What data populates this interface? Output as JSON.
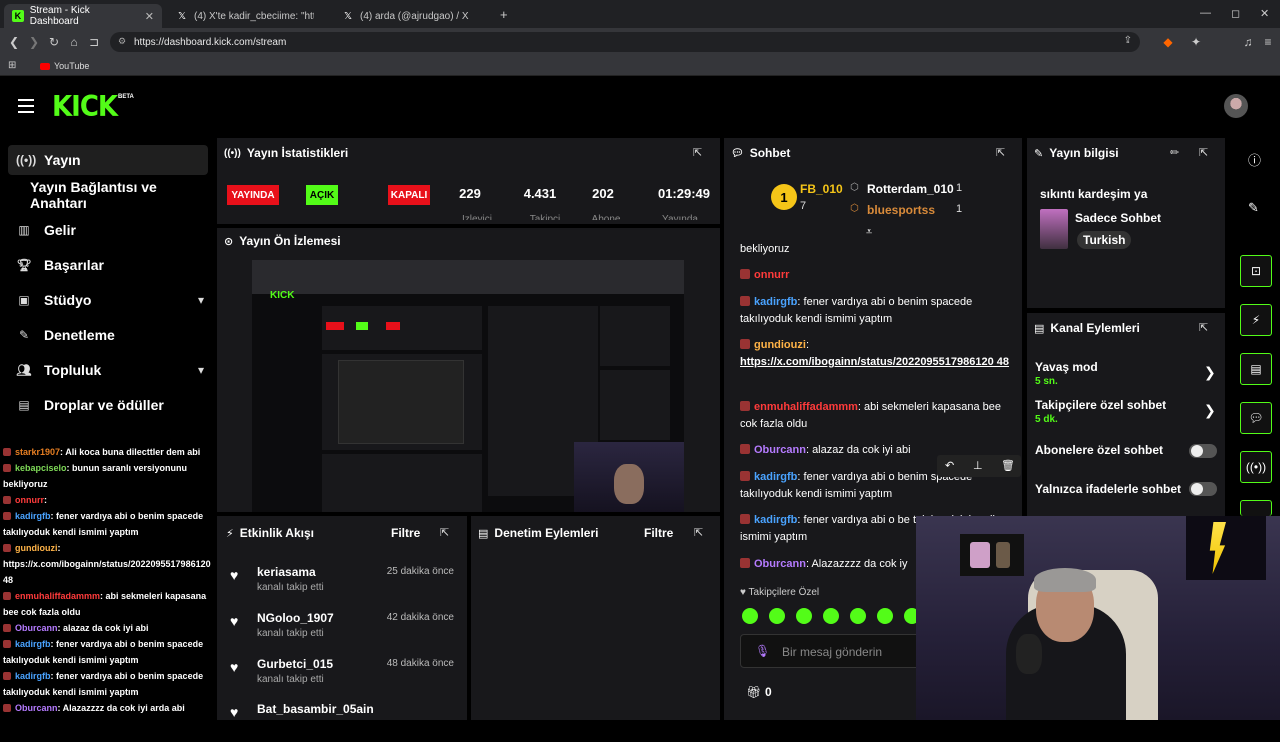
{
  "browser": {
    "tabs": [
      {
        "label": "Stream - Kick Dashboard",
        "active": true
      },
      {
        "label": "(4) X'te kadir_cbeciime: \"https://t.co/I..."
      },
      {
        "label": "(4) arda (@ajrudgao) / X"
      }
    ],
    "url": "https://dashboard.kick.com/stream",
    "bookmark": "YouTube"
  },
  "kick": {
    "logo": "KICK",
    "beta": "BETA"
  },
  "sidebar": {
    "items": [
      {
        "label": "Yayın"
      },
      {
        "label": "Yayın Bağlantısı ve Anahtarı"
      },
      {
        "label": "Gelir"
      },
      {
        "label": "Başarılar"
      },
      {
        "label": "Stüdyo"
      },
      {
        "label": "Denetleme"
      },
      {
        "label": "Topluluk"
      },
      {
        "label": "Droplar ve ödüller"
      }
    ]
  },
  "leftchat": [
    {
      "user": "starkr1907",
      "text": ": Ali koca buna dilecttler dem abi",
      "color": "#e67e22"
    },
    {
      "user": "kebapciselo",
      "text": ": bunun saranlı versiyonunu bekliyoruz",
      "color": "#7ed957"
    },
    {
      "user": "onnurr",
      "text": ":",
      "color": "#ff3b3b"
    },
    {
      "user": "kadirgfb",
      "text": ": fener vardıya abi o benim spacede takılıyoduk kendi ismimi yaptım",
      "color": "#4aa3ff"
    },
    {
      "user": "gundiouzi",
      "text": ": https://x.com/ibogainn/status/2022095517986120 48",
      "color": "#ffb347"
    },
    {
      "user": "enmuhaliffadammm",
      "text": ": abi sekmeleri kapasana bee cok fazla oldu",
      "color": "#ff3b3b"
    },
    {
      "user": "Oburcann",
      "text": ": alazaz da cok iyi abi",
      "color": "#b57bff"
    },
    {
      "user": "kadirgfb",
      "text": ": fener vardıya abi o benim spacede takılıyoduk kendi ismimi yaptım",
      "color": "#4aa3ff"
    },
    {
      "user": "kadirgfb",
      "text": ": fener vardıya abi o benim spacede takılıyoduk kendi ismimi yaptım",
      "color": "#4aa3ff"
    },
    {
      "user": "Oburcann",
      "text": ": Alazazzzz da cok iyi arda abi",
      "color": "#b57bff"
    }
  ],
  "stats": {
    "title": "Yayın İstatistikleri",
    "live": "YAYINDA",
    "open": "AÇIK",
    "closed": "KAPALI",
    "viewers": "229",
    "followers": "4.431",
    "subs": "202",
    "uptime": "01:29:49",
    "viewers_label": "İzleyici",
    "followers_label": "Takipçi",
    "subs_label": "Abone",
    "uptime_label": "Yayında"
  },
  "preview": {
    "title": "Yayın Ön İzlemesi"
  },
  "activity": {
    "title": "Etkinlik Akışı",
    "filter": "Filtre",
    "items": [
      {
        "name": "keriasama",
        "sub": "kanalı takip etti",
        "time": "25 dakika önce"
      },
      {
        "name": "NGoloo_1907",
        "sub": "kanalı takip etti",
        "time": "42 dakika önce"
      },
      {
        "name": "Gurbetci_015",
        "sub": "kanalı takip etti",
        "time": "48 dakika önce"
      },
      {
        "name": "Bat_basambir_05ain",
        "sub": "",
        "time": ""
      }
    ]
  },
  "moderation": {
    "title": "Denetim Eylemleri",
    "filter": "Filtre"
  },
  "chat": {
    "title": "Sohbet",
    "leaders": [
      {
        "name": "FB_010",
        "count": "7"
      },
      {
        "name": "Rotterdam_010",
        "count": "1"
      },
      {
        "name": "bluesportss",
        "count": "1"
      }
    ],
    "top_text": "bekliyoruz",
    "messages": [
      {
        "user": "onnurr",
        "text": "",
        "color": "#ff3b3b"
      },
      {
        "user": "kadirgfb",
        "text": ": fener vardıya abi o benim spacede takılıyoduk kendi ismimi yaptım",
        "color": "#4aa3ff"
      },
      {
        "user": "gundiouzi",
        "text": ":",
        "color": "#ffb347"
      },
      {
        "user": "",
        "text": "https://x.com/ibogainn/status/2022095517986120 48",
        "color": "#ffffff"
      },
      {
        "user": "enmuhaliffadammm",
        "text": ": abi sekmeleri kapasana bee cok fazla oldu",
        "color": "#ff3b3b"
      },
      {
        "user": "Oburcann",
        "text": ": alazaz da cok iyi abi",
        "color": "#b57bff"
      },
      {
        "user": "kadirgfb",
        "text": ": fener vardıya abi o benim spacede takılıyoduk kendi ismimi yaptım",
        "color": "#4aa3ff"
      },
      {
        "user": "kadirgfb",
        "text": ": fener vardıya abi o be takılıyoduk kendi ismimi yaptım",
        "color": "#4aa3ff"
      },
      {
        "user": "Oburcann",
        "text": ": Alazazzzz da cok iy",
        "color": "#b57bff"
      }
    ],
    "followers_only": "Takipçilere Özel",
    "input_placeholder": "Bir mesaj gönderin",
    "gift_count": "0"
  },
  "info": {
    "title": "Yayın bilgisi",
    "stream_title": "sıkıntı kardeşim ya",
    "category": "Sadece Sohbet",
    "language": "Turkish"
  },
  "channel_actions": {
    "title": "Kanal Eylemleri",
    "slow_mode": "Yavaş mod",
    "slow_value": "5 sn.",
    "followers_chat": "Takipçilere özel sohbet",
    "followers_value": "5 dk.",
    "subs_chat": "Abonelere özel sohbet",
    "emote_chat": "Yalnızca ifadelerle sohbet"
  },
  "colors": {
    "accent": "#53fc18",
    "live": "#e8101a",
    "panel": "#18181b"
  }
}
